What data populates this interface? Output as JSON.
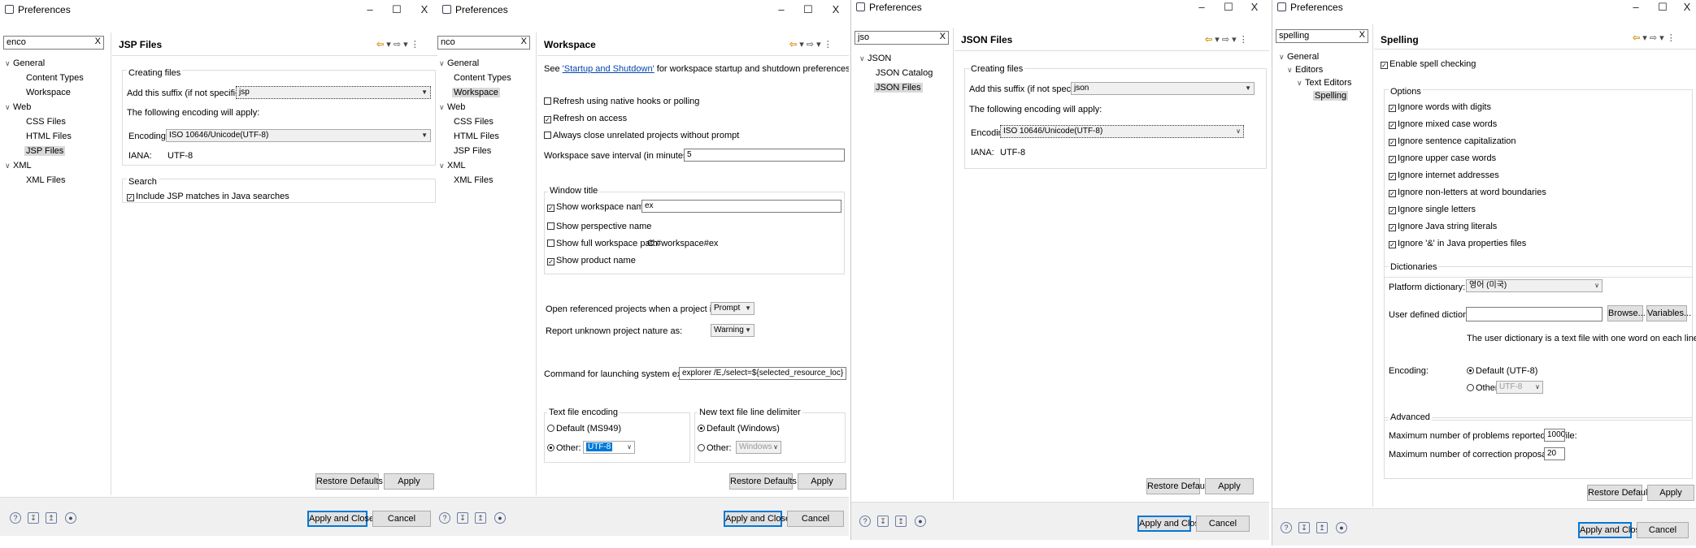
{
  "window_title": "Preferences",
  "close_glyph": "X",
  "footer": {
    "apply_close": "Apply and Close",
    "cancel": "Cancel"
  },
  "restore_defaults": "Restore Defaults",
  "apply": "Apply",
  "p1": {
    "filter": "enco",
    "tree": [
      "General",
      "Content Types",
      "Workspace",
      "Web",
      "CSS Files",
      "HTML Files",
      "JSP Files",
      "XML",
      "XML Files"
    ],
    "title": "JSP Files",
    "creating_files": "Creating files",
    "suffix_label": "Add this suffix (if not specified):",
    "suffix_value": "jsp",
    "encoding_apply": "The following encoding will apply:",
    "encoding_label": "Encoding:",
    "encoding_value": "ISO 10646/Unicode(UTF-8)",
    "iana_label": "IANA:",
    "iana_value": "UTF-8",
    "search_group": "Search",
    "include_jsp": "Include JSP matches in Java searches"
  },
  "p2": {
    "filter": "nco",
    "tree": [
      "General",
      "Content Types",
      "Workspace",
      "Web",
      "CSS Files",
      "HTML Files",
      "JSP Files",
      "XML",
      "XML Files"
    ],
    "title": "Workspace",
    "see_pre": "See ",
    "see_link": "'Startup and Shutdown'",
    "see_post": " for workspace startup and shutdown preferences.",
    "refresh_native": "Refresh using native hooks or polling",
    "refresh_access": "Refresh on access",
    "close_unrelated": "Always close unrelated projects without prompt",
    "save_interval_label": "Workspace save interval (in minutes):",
    "save_interval_value": "5",
    "window_title_group": "Window title",
    "show_ws_name": "Show workspace name:",
    "ws_name_value": "ex",
    "show_perspective": "Show perspective name",
    "show_full_path": "Show full workspace path:",
    "full_path_value": "C:#workspace#ex",
    "show_product": "Show product name",
    "open_ref_label": "Open referenced projects when a project is opened:",
    "open_ref_value": "Prompt",
    "unknown_nature_label": "Report unknown project nature as:",
    "unknown_nature_value": "Warning",
    "cmd_label": "Command for launching system explorer:",
    "cmd_value": "explorer /E,/select=${selected_resource_loc}",
    "text_enc_group": "Text file encoding",
    "enc_default": "Default (MS949)",
    "enc_other": "Other:",
    "enc_other_value": "UTF-8",
    "delim_group": "New text file line delimiter",
    "delim_default": "Default (Windows)",
    "delim_other": "Other:",
    "delim_other_value": "Windows"
  },
  "p3": {
    "filter": "jso",
    "tree": [
      "JSON",
      "JSON Catalog",
      "JSON Files"
    ],
    "title": "JSON Files",
    "creating_files": "Creating files",
    "suffix_label": "Add this suffix (if not specified):",
    "suffix_value": "json",
    "encoding_apply": "The following encoding will apply:",
    "encoding_label": "Encoding:",
    "encoding_value": "ISO 10646/Unicode(UTF-8)",
    "iana_label": "IANA:",
    "iana_value": "UTF-8"
  },
  "p4": {
    "filter": "spelling",
    "tree": [
      "General",
      "Editors",
      "Text Editors",
      "Spelling"
    ],
    "title": "Spelling",
    "enable": "Enable spell checking",
    "options_group": "Options",
    "options": [
      "Ignore words with digits",
      "Ignore mixed case words",
      "Ignore sentence capitalization",
      "Ignore upper case words",
      "Ignore internet addresses",
      "Ignore non-letters at word boundaries",
      "Ignore single letters",
      "Ignore Java string literals",
      "Ignore '&' in Java properties files"
    ],
    "dict_group": "Dictionaries",
    "platform_label": "Platform dictionary:",
    "platform_value": "영어 (미국)",
    "user_label": "User defined dictionary:",
    "browse": "Browse...",
    "variables": "Variables...",
    "user_note": "The user dictionary is a text file with one word on each line",
    "encoding_label": "Encoding:",
    "enc_default": "Default (UTF-8)",
    "enc_other": "Other:",
    "enc_other_value": "UTF-8",
    "advanced_group": "Advanced",
    "max_problems_label": "Maximum number of problems reported per file:",
    "max_problems_value": "1000",
    "max_corrections_label": "Maximum number of correction proposals:",
    "max_corrections_value": "20"
  }
}
